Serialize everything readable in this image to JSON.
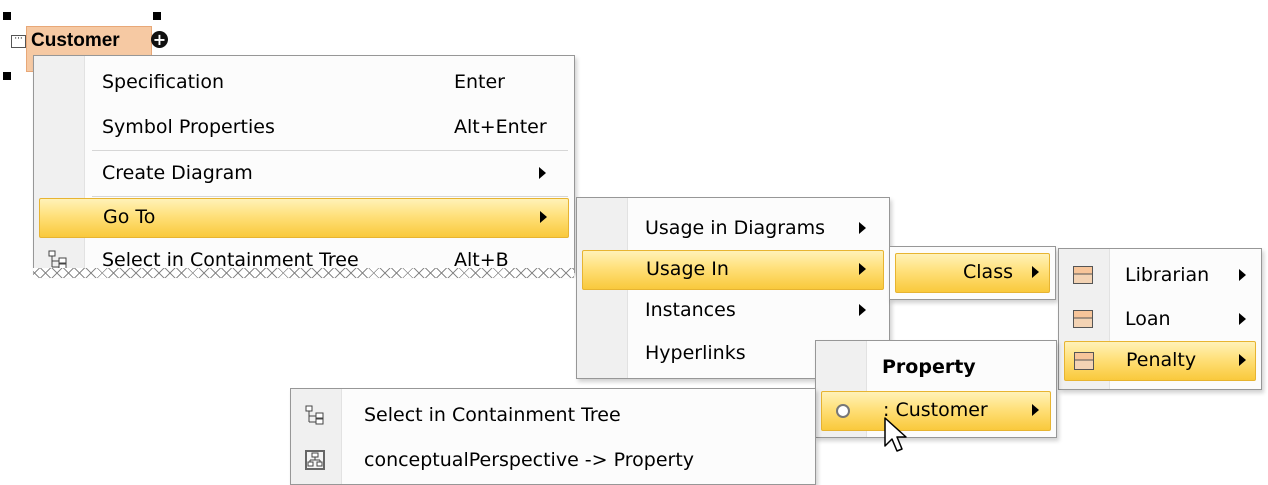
{
  "symbol": {
    "name": "Customer"
  },
  "context_menu": {
    "items": [
      {
        "label": "Specification",
        "shortcut": "Enter"
      },
      {
        "label": "Symbol Properties",
        "shortcut": "Alt+Enter"
      },
      {
        "label": "Create Diagram",
        "shortcut": ""
      },
      {
        "label": "Go To",
        "shortcut": ""
      },
      {
        "label": "Select in Containment Tree",
        "shortcut": "Alt+B"
      }
    ]
  },
  "goto_menu": {
    "items": [
      {
        "label": "Usage in Diagrams"
      },
      {
        "label": "Usage In"
      },
      {
        "label": "Instances"
      },
      {
        "label": "Hyperlinks"
      }
    ]
  },
  "usage_in_menu": {
    "items": [
      {
        "label": "Class"
      }
    ]
  },
  "class_menu": {
    "items": [
      {
        "label": "Librarian"
      },
      {
        "label": "Loan"
      },
      {
        "label": "Penalty"
      }
    ]
  },
  "property_menu": {
    "header": "Property",
    "items": [
      {
        "label": ": Customer"
      }
    ]
  },
  "customer_property_menu": {
    "items": [
      {
        "label": "Select in Containment Tree"
      },
      {
        "label": "conceptualPerspective -> Property"
      }
    ]
  },
  "icons": {
    "tree": "containment-tree-icon",
    "class": "class-icon",
    "property": "property-icon",
    "diagram": "diagram-icon"
  },
  "colors": {
    "highlight": "#ffe07a",
    "symbol_fill": "#f6c9a3",
    "menu_bg": "#fcfcfc"
  }
}
